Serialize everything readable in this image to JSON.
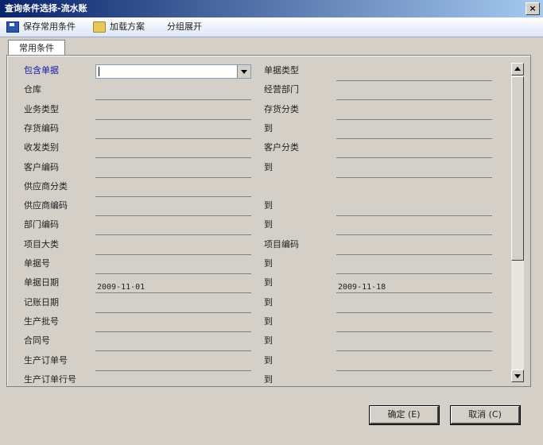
{
  "window": {
    "title": "查询条件选择-流水账",
    "close_label": "×"
  },
  "toolbar": {
    "save_label": "保存常用条件",
    "load_label": "加载方案",
    "group_label": "分组展开"
  },
  "tabs": [
    {
      "label": "常用条件"
    }
  ],
  "left_rows": [
    {
      "label": "包含单据",
      "value": ""
    },
    {
      "label": "仓库",
      "value": ""
    },
    {
      "label": "业务类型",
      "value": ""
    },
    {
      "label": "存货编码",
      "value": ""
    },
    {
      "label": "收发类别",
      "value": ""
    },
    {
      "label": "客户编码",
      "value": ""
    },
    {
      "label": "供应商分类",
      "value": ""
    },
    {
      "label": "供应商编码",
      "value": ""
    },
    {
      "label": "部门编码",
      "value": ""
    },
    {
      "label": "项目大类",
      "value": ""
    },
    {
      "label": "单据号",
      "value": ""
    },
    {
      "label": "单据日期",
      "value": "2009-11-01"
    },
    {
      "label": "记账日期",
      "value": ""
    },
    {
      "label": "生产批号",
      "value": ""
    },
    {
      "label": "合同号",
      "value": ""
    },
    {
      "label": "生产订单号",
      "value": ""
    },
    {
      "label": "生产订单行号",
      "value": ""
    }
  ],
  "right_rows": [
    {
      "label": "单据类型",
      "value": ""
    },
    {
      "label": "经营部门",
      "value": ""
    },
    {
      "label": "存货分类",
      "value": ""
    },
    {
      "label": "到",
      "value": ""
    },
    {
      "label": "客户分类",
      "value": ""
    },
    {
      "label": "到",
      "value": ""
    },
    {
      "label": "",
      "value": ""
    },
    {
      "label": "到",
      "value": ""
    },
    {
      "label": "到",
      "value": ""
    },
    {
      "label": "项目编码",
      "value": ""
    },
    {
      "label": "到",
      "value": ""
    },
    {
      "label": "到",
      "value": "2009-11-18"
    },
    {
      "label": "到",
      "value": ""
    },
    {
      "label": "到",
      "value": ""
    },
    {
      "label": "到",
      "value": ""
    },
    {
      "label": "到",
      "value": ""
    },
    {
      "label": "到",
      "value": ""
    }
  ],
  "buttons": {
    "ok_label": "确定 (E)",
    "cancel_label": "取消 (C)"
  },
  "colors": {
    "highlight_label": "#1a1aa8",
    "title_gradient_start": "#0a246a"
  }
}
